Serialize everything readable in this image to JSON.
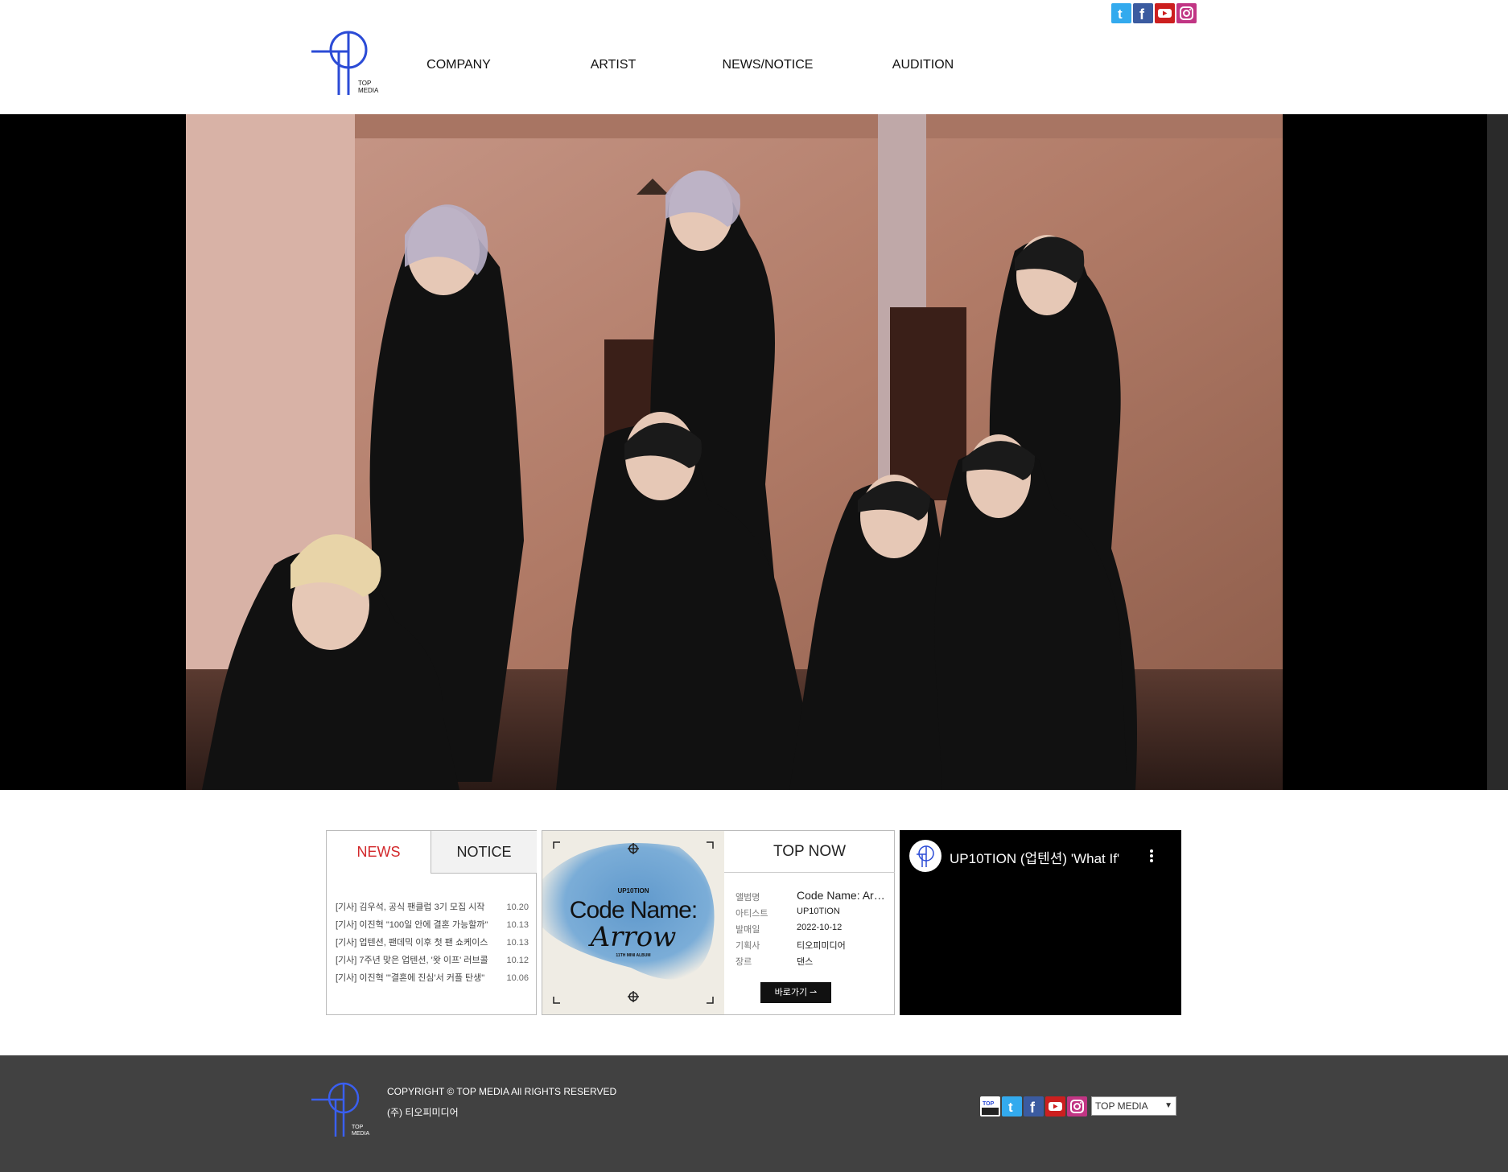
{
  "header": {
    "logo_text": "TOP MEDIA",
    "nav": [
      "COMPANY",
      "ARTIST",
      "NEWS/NOTICE",
      "AUDITION"
    ],
    "social_icons": [
      "twitter-icon",
      "facebook-icon",
      "youtube-icon",
      "instagram-icon"
    ]
  },
  "news": {
    "tabs": [
      "NEWS",
      "NOTICE"
    ],
    "items": [
      {
        "title": "[기사] 김우석, 공식 팬클럽 3기 모집 시작",
        "date": "10.20"
      },
      {
        "title": "[기사] 이진혁 \"100일 안에 결혼 가능할까\"",
        "date": "10.13"
      },
      {
        "title": "[기사] 업텐션, 팬데믹 이후 첫 팬 쇼케이스",
        "date": "10.13"
      },
      {
        "title": "[기사] 7주년 맞은 업텐션, '왓 이프' 러브콜",
        "date": "10.12"
      },
      {
        "title": "[기사] 이진혁 \"'결혼에 진심'서 커플 탄생\"",
        "date": "10.06"
      }
    ]
  },
  "album": {
    "cover_artist": "UP10TION",
    "cover_title_line1": "Code Name:",
    "cover_title_line2": "Arrow",
    "cover_subtitle": "11TH MINI ALBUM",
    "section_title": "TOP NOW",
    "rows": [
      {
        "label": "앨범명",
        "value": "Code Name: Arrow"
      },
      {
        "label": "아티스트",
        "value": "UP10TION"
      },
      {
        "label": "발매일",
        "value": "2022-10-12"
      },
      {
        "label": "기획사",
        "value": "티오피미디어"
      },
      {
        "label": "장르",
        "value": "댄스"
      }
    ],
    "button": "바로가기"
  },
  "video": {
    "title": "UP10TION (업텐션) 'What If'"
  },
  "footer": {
    "logo_text": "TOP MEDIA",
    "copyright": "COPYRIGHT © TOP MEDIA All RIGHTS RESERVED",
    "company": "(주) 티오피미디어",
    "mall_text": "TOP MALL",
    "family_select": "TOP MEDIA"
  },
  "colors": {
    "brand_blue": "#2b4bd6",
    "news_red": "#d2282b",
    "footer_bg": "#414141"
  }
}
